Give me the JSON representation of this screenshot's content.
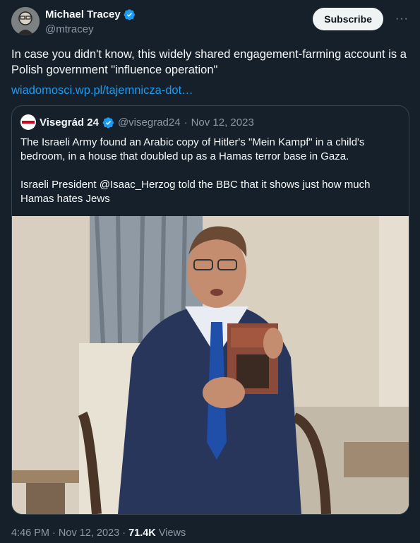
{
  "author": {
    "name": "Michael Tracey",
    "handle": "@mtracey"
  },
  "actions": {
    "subscribe_label": "Subscribe",
    "more_label": "···"
  },
  "tweet": {
    "text": "In case you didn't know, this widely shared engagement-farming account is a Polish government \"influence operation\"",
    "link": "wiadomosci.wp.pl/tajemnicza-dot…"
  },
  "quoted": {
    "name": "Visegrád 24",
    "handle": "@visegrad24",
    "separator": "·",
    "date": "Nov 12, 2023",
    "text": "The Israeli Army found an Arabic copy of Hitler's \"Mein Kampf\" in a child's bedroom, in a house that doubled up as a Hamas terror base in Gaza.\n\nIsraeli President @Isaac_Herzog told the BBC that it shows just how much Hamas hates Jews"
  },
  "footer": {
    "time": "4:46 PM",
    "separator": "·",
    "date": "Nov 12, 2023",
    "views_count": "71.4K",
    "views_label": "Views"
  },
  "colors": {
    "background": "#15202b",
    "verified": "#1d9bf0",
    "link": "#1d9bf0"
  }
}
